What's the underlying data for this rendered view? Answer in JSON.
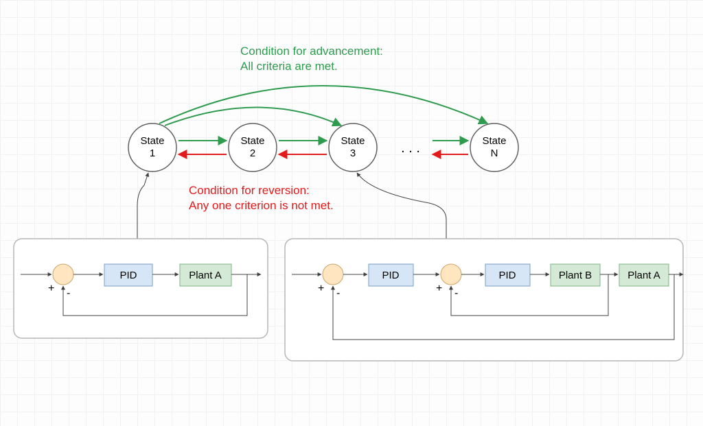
{
  "colors": {
    "green": "#2e9b4f",
    "red": "#e11b1b",
    "stateFill": "#ffffff",
    "stateStroke": "#606060",
    "pidFill": "#d6e6f6",
    "pidStroke": "#7a9fc4",
    "plantFill": "#d5ead6",
    "plantStroke": "#7fb082",
    "sumFill": "#ffe5c0",
    "sumStroke": "#c9a56b",
    "cardStroke": "#b6b6b6",
    "conn": "#404040"
  },
  "advText": {
    "line1": "Condition for advancement:",
    "line2": "All criteria are met."
  },
  "revText": {
    "line1": "Condition for reversion:",
    "line2": "Any one criterion is not met."
  },
  "states": {
    "s1": {
      "top": "State",
      "bottom": "1"
    },
    "s2": {
      "top": "State",
      "bottom": "2"
    },
    "s3": {
      "top": "State",
      "bottom": "3"
    },
    "sN": {
      "top": "State",
      "bottom": "N"
    }
  },
  "ellipsis": ". . .",
  "blocks": {
    "pid": "PID",
    "plantA": "Plant A",
    "plantB": "Plant B"
  },
  "signs": {
    "plus": "+",
    "minus": "-"
  }
}
